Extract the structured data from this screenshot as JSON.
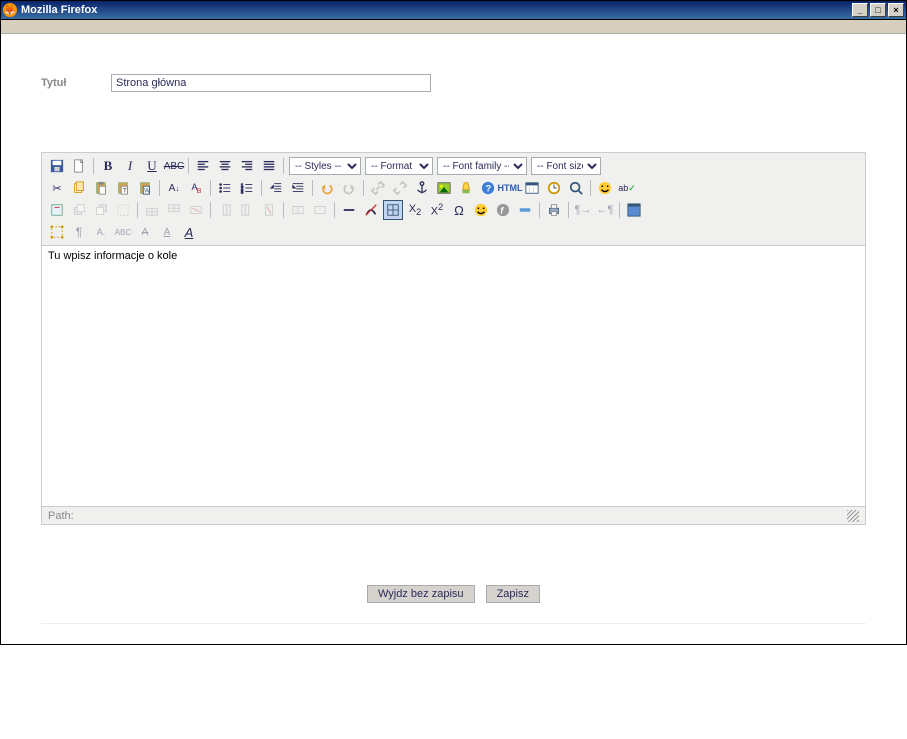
{
  "window": {
    "title": "Mozilla Firefox"
  },
  "form": {
    "title_label": "Tytuł",
    "title_value": "Strona główna"
  },
  "toolbar": {
    "selects": {
      "styles": "-- Styles --",
      "format": "-- Format --",
      "family": "-- Font family --",
      "size": "-- Font size --"
    },
    "html_label": "HTML"
  },
  "editor": {
    "content": "Tu wpisz informacje o kole",
    "path_label": "Path:"
  },
  "actions": {
    "exit_no_save": "Wyjdz bez zapisu",
    "save": "Zapisz"
  }
}
